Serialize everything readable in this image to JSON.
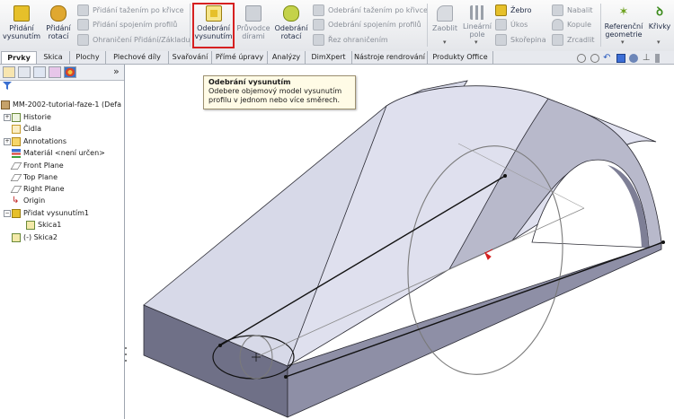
{
  "ribbon": {
    "buttons_big": [
      {
        "label1": "Přidání",
        "label2": "vysunutím"
      },
      {
        "label1": "Přidání",
        "label2": "rotací"
      },
      {
        "label1": "Odebrání",
        "label2": "vysunutím"
      },
      {
        "label1": "Průvodce",
        "label2": "dírami"
      },
      {
        "label1": "Odebrání",
        "label2": "rotací"
      },
      {
        "label1": "Zaoblit",
        "label2": ""
      },
      {
        "label1": "Lineární",
        "label2": "pole"
      },
      {
        "label1": "Referenční",
        "label2": "geometrie"
      },
      {
        "label1": "Křivky",
        "label2": ""
      }
    ],
    "small_left": [
      "Přidání tažením po křivce",
      "Přidání spojením profilů",
      "Ohraničení Přidání/Základu"
    ],
    "small_mid": [
      "Odebrání tažením po křivce",
      "Odebrání spojením profilů",
      "Řez ohraničením"
    ],
    "small_right1": [
      "Žebro",
      "Úkos",
      "Skořepina"
    ],
    "small_right2": [
      "Nabalit",
      "Kopule",
      "Zrcadlit"
    ]
  },
  "tabs": [
    "Prvky",
    "Skica",
    "Plochy",
    "Plechové díly",
    "Svařování",
    "Přímé úpravy",
    "Analýzy",
    "DimXpert",
    "Nástroje rendrování",
    "Produkty Office"
  ],
  "tooltip": {
    "title": "Odebrání vysunutím",
    "line1": "Odebere objemový model vysunutím",
    "line2": "profilu v jednom nebo více směrech."
  },
  "tree": {
    "root": "MM-2002-tutorial-faze-1  (Defa",
    "items": [
      "Historie",
      "Čidla",
      "Annotations",
      "Materiál <není určen>",
      "Front Plane",
      "Top Plane",
      "Right Plane",
      "Origin",
      "Přidat vysunutím1",
      "Skica1",
      "(-) Skica2"
    ]
  },
  "panel_chevron": "»",
  "colors": {
    "accent_red": "#d62020",
    "model_top": "#d9dbe9",
    "model_side": "#8e8fa6",
    "model_front": "#6f7087"
  }
}
